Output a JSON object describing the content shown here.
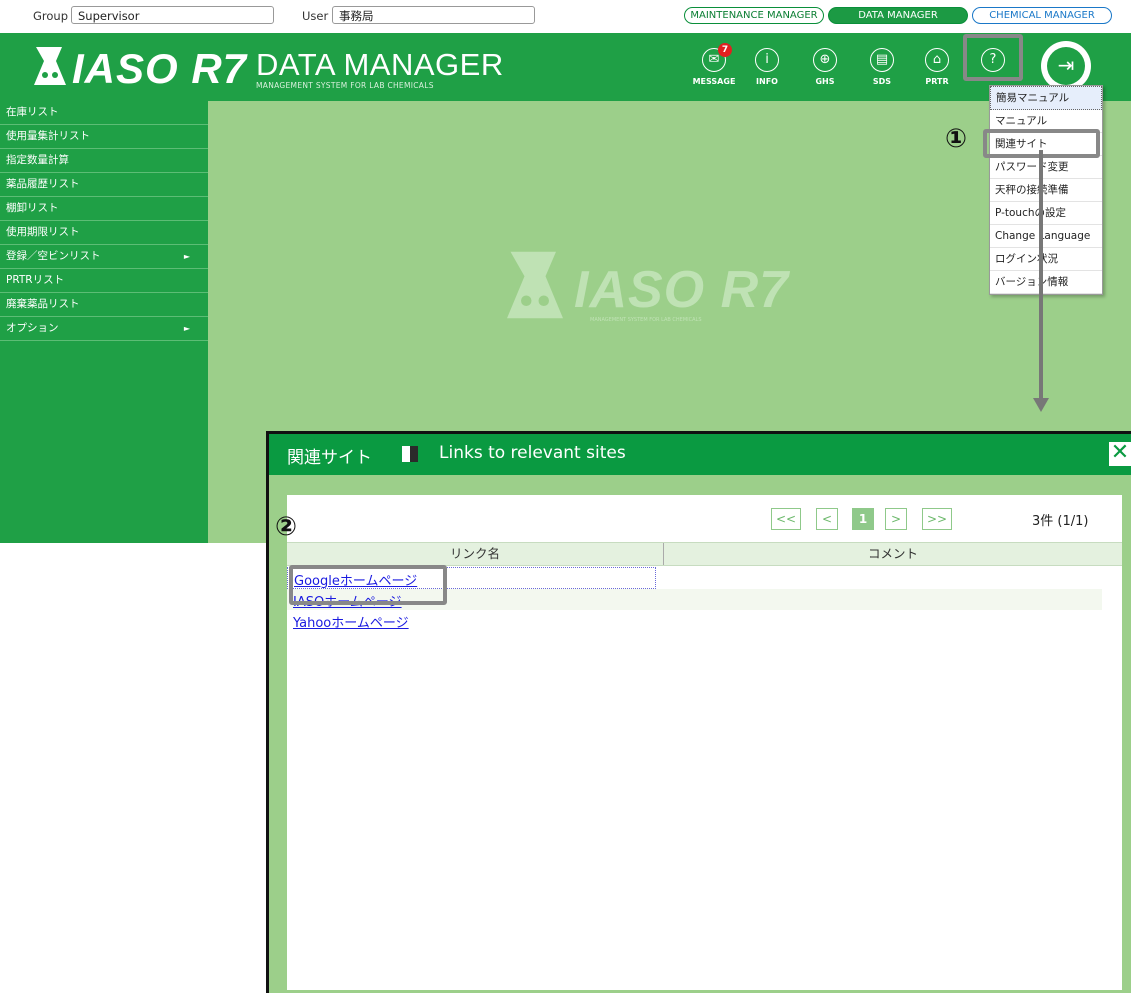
{
  "topbar": {
    "group_label": "Group",
    "group_value": "Supervisor",
    "user_label": "User",
    "user_value": "事務局",
    "managers": [
      "MAINTENANCE MANAGER",
      "DATA MANAGER",
      "CHEMICAL MANAGER"
    ]
  },
  "header": {
    "logo": "IASO R7",
    "app_name": "DATA MANAGER",
    "subtitle": "MANAGEMENT SYSTEM FOR LAB CHEMICALS",
    "message_badge": "7",
    "icons": [
      {
        "caption": "MESSAGE",
        "icon": "mail-icon"
      },
      {
        "caption": "INFO",
        "icon": "info-icon"
      },
      {
        "caption": "GHS",
        "icon": "globe-icon"
      },
      {
        "caption": "SDS",
        "icon": "document-icon"
      },
      {
        "caption": "PRTR",
        "icon": "factory-icon"
      },
      {
        "caption": "",
        "icon": "help-icon"
      }
    ]
  },
  "sidebar": {
    "items": [
      {
        "label": "在庫リスト"
      },
      {
        "label": "使用量集計リスト"
      },
      {
        "label": "指定数量計算"
      },
      {
        "label": "薬品履歴リスト"
      },
      {
        "label": "棚卸リスト"
      },
      {
        "label": "使用期限リスト"
      },
      {
        "label": "登録／空ビンリスト",
        "arrow": "►"
      },
      {
        "label": "PRTRリスト"
      },
      {
        "label": "廃棄薬品リスト"
      },
      {
        "label": "オプション",
        "arrow": "►"
      }
    ]
  },
  "center_logo": {
    "text": "IASO R7",
    "sub": "MANAGEMENT SYSTEM FOR LAB CHEMICALS"
  },
  "help_menu": {
    "items": [
      "簡易マニュアル",
      "マニュアル",
      "関連サイト",
      "パスワード変更",
      "天秤の接続準備",
      "P-touchの設定",
      "Change Language",
      "ログイン状況",
      "バージョン情報"
    ]
  },
  "annotations": {
    "step1": "①",
    "step2": "②"
  },
  "dialog": {
    "title": "関連サイト",
    "title_en": "Links to relevant sites",
    "close": "✕",
    "pager": {
      "first": "<<",
      "prev": "<",
      "page": "1",
      "next": ">",
      "last": ">>"
    },
    "count": "3件 (1/1)",
    "columns": [
      "リンク名",
      "コメント"
    ],
    "links": [
      "Googleホームページ",
      "IASOホームページ",
      "Yahooホームページ"
    ]
  }
}
